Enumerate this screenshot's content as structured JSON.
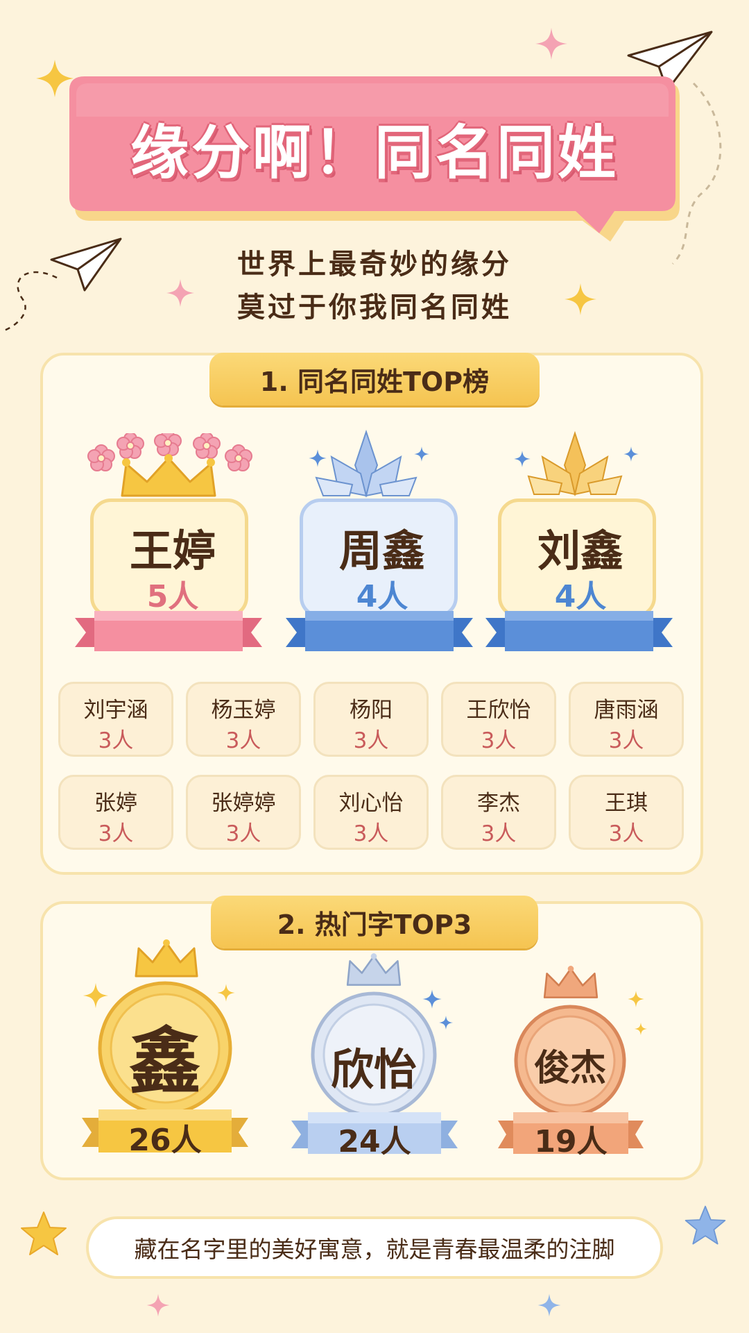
{
  "title": "缘分啊！同名同姓",
  "subtitle": [
    "世界上最奇妙的缘分",
    "莫过于你我同名同姓"
  ],
  "section1": {
    "heading": "1. 同名同姓TOP榜",
    "top3": [
      {
        "name": "王婷",
        "count": "5人",
        "style": "pink"
      },
      {
        "name": "周鑫",
        "count": "4人",
        "style": "blue"
      },
      {
        "name": "刘鑫",
        "count": "4人",
        "style": "gold-blue"
      }
    ],
    "grid": [
      {
        "name": "刘宇涵",
        "count": "3人"
      },
      {
        "name": "杨玉婷",
        "count": "3人"
      },
      {
        "name": "杨阳",
        "count": "3人"
      },
      {
        "name": "王欣怡",
        "count": "3人"
      },
      {
        "name": "唐雨涵",
        "count": "3人"
      },
      {
        "name": "张婷",
        "count": "3人"
      },
      {
        "name": "张婷婷",
        "count": "3人"
      },
      {
        "name": "刘心怡",
        "count": "3人"
      },
      {
        "name": "李杰",
        "count": "3人"
      },
      {
        "name": "王琪",
        "count": "3人"
      }
    ]
  },
  "section2": {
    "heading": "2. 热门字TOP3",
    "medals": [
      {
        "char": "鑫",
        "count": "26人",
        "tier": "gold"
      },
      {
        "char": "欣怡",
        "count": "24人",
        "tier": "silver"
      },
      {
        "char": "俊杰",
        "count": "19人",
        "tier": "bronze"
      }
    ]
  },
  "footer": "藏在名字里的美好寓意，就是青春最温柔的注脚",
  "colors": {
    "pink": "#f47f93",
    "blue": "#5b8fd9",
    "gold": "#f5c451",
    "background": "#fdf3dc"
  },
  "icons": [
    "sparkle-icon",
    "paper-plane-icon",
    "flower-icon",
    "crown-icon",
    "crystal-crown-icon",
    "star-icon"
  ]
}
